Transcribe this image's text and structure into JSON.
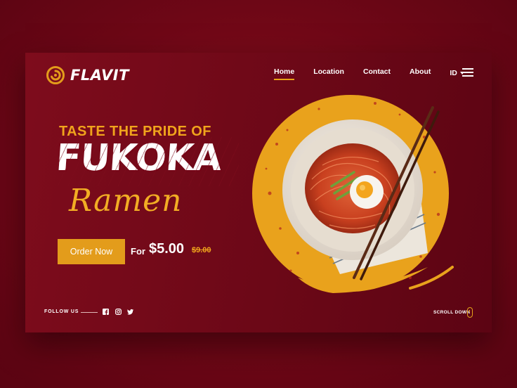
{
  "brand": {
    "name": "FLAVIT",
    "logo_icon": "swirl-logo-icon",
    "accent": "#e39c1b"
  },
  "nav": {
    "items": [
      {
        "label": "Home",
        "active": true
      },
      {
        "label": "Location",
        "active": false
      },
      {
        "label": "Contact",
        "active": false
      },
      {
        "label": "About",
        "active": false
      }
    ],
    "language": "ID",
    "menu_icon": "hamburger-icon"
  },
  "hero": {
    "kicker": "TASTE THE PRIDE OF",
    "headline": "FUKOKA",
    "script": "Ramen",
    "cta_label": "Order Now",
    "price_prefix": "For",
    "price": "$5.00",
    "old_price": "$9.00"
  },
  "footer": {
    "follow_label": "FOLLOW US",
    "socials": [
      "facebook-icon",
      "instagram-icon",
      "twitter-icon"
    ],
    "scroll_label": "SCROLL DOWN",
    "scroll_icon": "mouse-icon"
  },
  "colors": {
    "background": "#6e0716",
    "card": "#7e0c1c",
    "accent": "#e39c1b",
    "text": "#ffffff"
  }
}
